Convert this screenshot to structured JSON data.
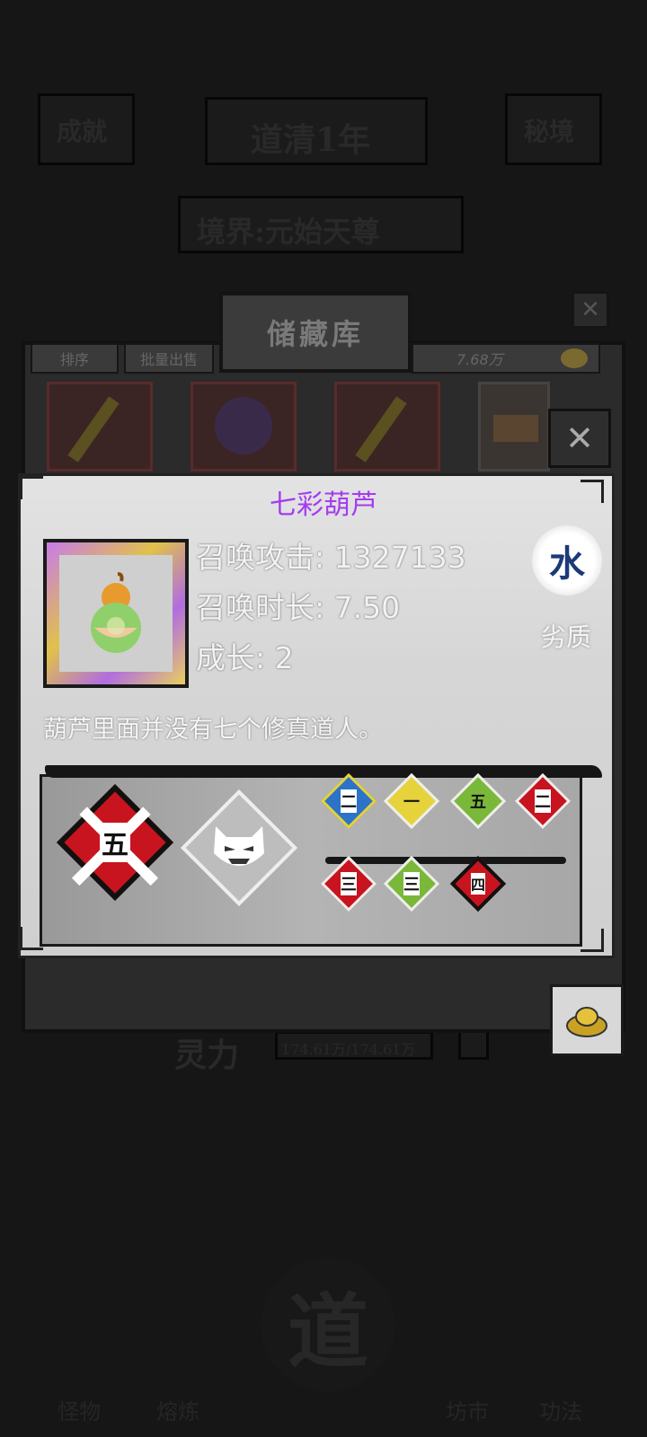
{
  "background": {
    "top_left_button": "成就",
    "year_label": "道清1年",
    "top_right_button": "秘境",
    "realm_label": "境界:元始天尊",
    "spirit_label": "灵力",
    "spirit_value": "174.61万/174.61万",
    "nav": [
      "怪物",
      "熔炼",
      "道",
      "坊市",
      "功法"
    ]
  },
  "storage": {
    "title": "储藏库",
    "sort_button": "排序",
    "batch_sell_button": "批量出售",
    "currency_amount": "7.68万",
    "close_symbol": "✕"
  },
  "item": {
    "name": "七彩葫芦",
    "stats": [
      {
        "label": "召唤攻击:",
        "value": "1327133"
      },
      {
        "label": "召唤时长:",
        "value": "7.50"
      },
      {
        "label": "成长:",
        "value": "2"
      }
    ],
    "element": "水",
    "quality": "劣质",
    "description": "葫芦里面并没有七个修真道人。",
    "close_symbol": "✕",
    "skills": {
      "big_left_rank": "五",
      "small_top": [
        "二",
        "一",
        "五",
        "二"
      ],
      "small_bottom": [
        "三",
        "三",
        "四"
      ]
    }
  },
  "colors": {
    "item_name": "#a43cf0",
    "element_text": "#1c3a78",
    "red_rank": "#c8141e",
    "green_rank": "#7ab83a",
    "yellow_rank": "#e6d23a",
    "blue_rank": "#2d73c8"
  }
}
